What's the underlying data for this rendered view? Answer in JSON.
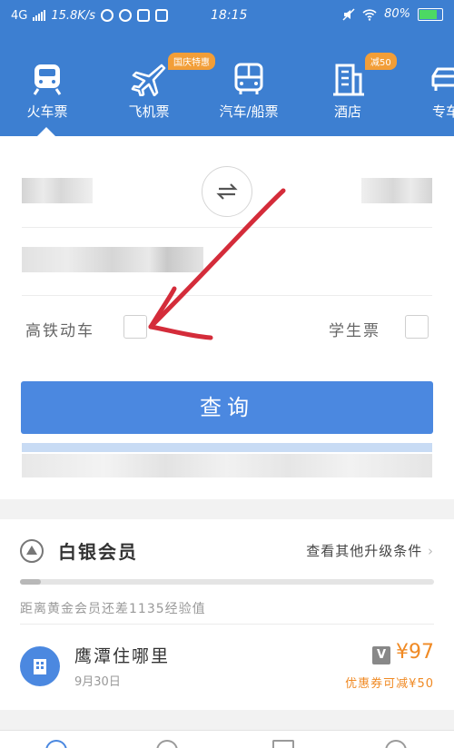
{
  "status_bar": {
    "network": "4G",
    "speed": "15.8K/s",
    "time": "18:15",
    "battery": "80%",
    "battery_level": 0.8
  },
  "tabs": [
    {
      "label": "火车票",
      "icon": "train-icon",
      "badge": ""
    },
    {
      "label": "飞机票",
      "icon": "airplane-icon",
      "badge": "国庆特惠"
    },
    {
      "label": "汽车/船票",
      "icon": "bus-icon",
      "badge": ""
    },
    {
      "label": "酒店",
      "icon": "hotel-icon",
      "badge": "减50"
    },
    {
      "label": "专车",
      "icon": "car-icon",
      "badge": ""
    }
  ],
  "form": {
    "options": {
      "high_speed_label": "高铁动车",
      "student_label": "学生票"
    },
    "search_label": "查询"
  },
  "member": {
    "title": "白银会员",
    "upgrade_link": "查看其他升级条件",
    "progress_text": "距离黄金会员还差1135经验值",
    "progress": 0.05
  },
  "hotel": {
    "title": "鹰潭住哪里",
    "date": "9月30日",
    "badge": "V",
    "price": "¥97",
    "discount": "优惠券可减¥50"
  },
  "colors": {
    "brand": "#3d7fd1",
    "button": "#4b88e0",
    "price": "#f08a24",
    "annotation": "#d42c3a"
  }
}
